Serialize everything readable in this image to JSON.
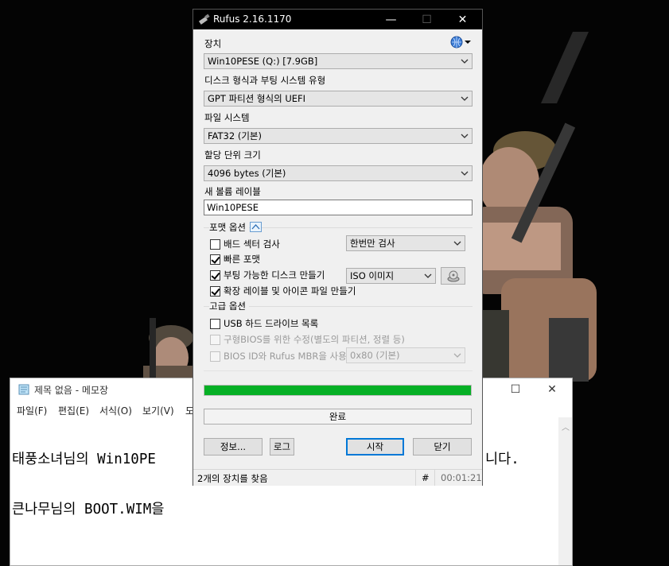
{
  "rufus": {
    "title": "Rufus 2.16.1170",
    "device_label": "장치",
    "device_value": "Win10PESE (Q:) [7.9GB]",
    "partition_label": "디스크 형식과 부팅 시스템 유형",
    "partition_value": "GPT 파티션 형식의 UEFI",
    "filesystem_label": "파일 시스템",
    "filesystem_value": "FAT32 (기본)",
    "cluster_label": "할당 단위 크기",
    "cluster_value": "4096 bytes (기본)",
    "volume_label": "새 볼륨 레이블",
    "volume_value": "Win10PESE",
    "format_options_title": "포맷 옵션",
    "bad_sectors_label": "배드 섹터 검사",
    "bad_sectors_checked": false,
    "bad_sectors_passes": "한번만 검사",
    "quick_format_label": "빠른 포맷",
    "quick_format_checked": true,
    "bootable_label": "부팅 가능한 디스크 만들기",
    "bootable_checked": true,
    "boot_type": "ISO 이미지",
    "extended_label_label": "확장 레이블 및 아이콘 파일 만들기",
    "extended_label_checked": true,
    "advanced_title": "고급 옵션",
    "usb_hdd_label": "USB 하드 드라이브 목록",
    "usb_hdd_checked": false,
    "old_bios_label": "구형BIOS를 위한 수정(별도의 파티션, 정렬 등)",
    "old_bios_checked": false,
    "bios_id_label": "BIOS ID와 Rufus MBR을 사용",
    "bios_id_checked": false,
    "bios_id_value": "0x80 (기본)",
    "progress": 1.0,
    "status": "완료",
    "about_button": "정보...",
    "log_button": "로그",
    "start_button": "시작",
    "close_button": "닫기",
    "statusbar_text": "2개의 장치를 찾음",
    "statusbar_hash": "#",
    "statusbar_time": "00:01:21"
  },
  "notepad": {
    "title": "제목 없음 - 메모장",
    "menu": [
      "파일(F)",
      "편집(E)",
      "서식(O)",
      "보기(V)",
      "도"
    ],
    "line1": "태풍소녀님의 Win10PE",
    "line1_tail": "니다.",
    "line2": "큰나무님의 BOOT.WIM을"
  },
  "colors": {
    "progress_green": "#06b025",
    "rufus_titlebar": "#000000",
    "focus_blue": "#0078d7"
  },
  "icons": [
    "rufus-usb-icon",
    "language-globe-icon",
    "save-iso-icon",
    "collapse-arrow-icon",
    "notepad-icon"
  ]
}
